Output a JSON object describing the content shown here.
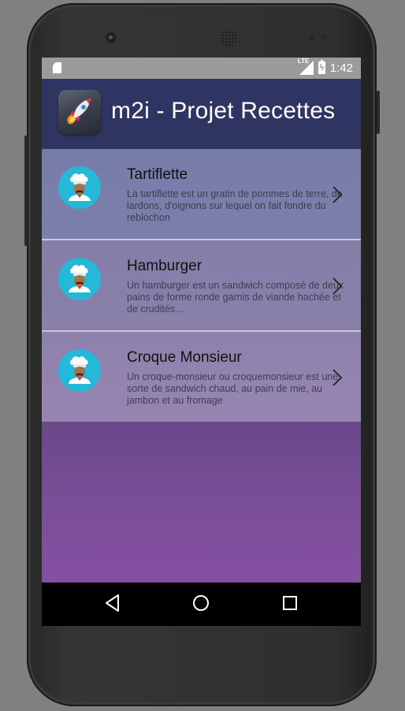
{
  "status_bar": {
    "time": "1:42",
    "network_label": "LTE",
    "icons": [
      "sd-card-icon",
      "signal-icon",
      "battery-charging-icon"
    ]
  },
  "app_bar": {
    "title": "m2i - Projet Recettes",
    "icon": "rocket-icon"
  },
  "recipes": [
    {
      "title": "Tartiflette",
      "description": "La tartiflette est un gratin de pommes de terre, de lardons, d'oignons sur lequel on fait fondre du reblochon",
      "icon": "chef-avatar-icon"
    },
    {
      "title": "Hamburger",
      "description": "Un hamburger est un sandwich composé de deux pains de forme ronde garnis de viande hachée et de crudités...",
      "icon": "chef-avatar-icon"
    },
    {
      "title": "Croque Monsieur",
      "description": "Un croque-monsieur ou croquemonsieur est une sorte de sandwich chaud, au pain de mie, au jambon et au fromage",
      "icon": "chef-avatar-icon"
    }
  ],
  "nav_bar": {
    "buttons": [
      "back-icon",
      "home-icon",
      "recents-icon"
    ]
  },
  "colors": {
    "app_bar": "#2e3564",
    "status_bar": "#9b9b9b",
    "avatar_bg": "#25b8d8",
    "background_top": "#6a4889",
    "background_bottom": "#864fa3"
  }
}
